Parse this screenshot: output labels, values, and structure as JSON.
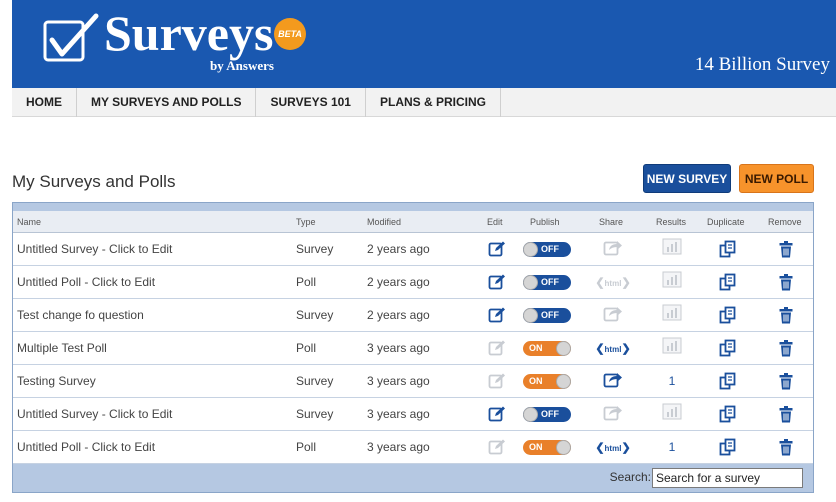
{
  "brand": {
    "logo_text": "Surveys",
    "logo_by": "by Answers",
    "beta": "BETA",
    "tagline": "14 Billion Survey"
  },
  "nav": {
    "items": [
      {
        "label": "HOME"
      },
      {
        "label": "MY SURVEYS AND POLLS"
      },
      {
        "label": "SURVEYS 101"
      },
      {
        "label": "PLANS & PRICING"
      }
    ]
  },
  "page": {
    "title": "My Surveys and Polls",
    "new_survey": "NEW SURVEY",
    "new_poll": "NEW POLL"
  },
  "table": {
    "columns": {
      "name": "Name",
      "type": "Type",
      "modified": "Modified",
      "edit": "Edit",
      "publish": "Publish",
      "share": "Share",
      "results": "Results",
      "duplicate": "Duplicate",
      "remove": "Remove"
    },
    "rows": [
      {
        "name": "Untitled Survey - Click to Edit",
        "type": "Survey",
        "modified": "2 years ago",
        "edit_enabled": true,
        "publish": "OFF",
        "share": "share-dim",
        "results": "chart-dim"
      },
      {
        "name": "Untitled Poll - Click to Edit",
        "type": "Poll",
        "modified": "2 years ago",
        "edit_enabled": true,
        "publish": "OFF",
        "share": "html-dim",
        "results": "chart-dim"
      },
      {
        "name": "Test change fo question",
        "type": "Survey",
        "modified": "2 years ago",
        "edit_enabled": true,
        "publish": "OFF",
        "share": "share-dim",
        "results": "chart-dim"
      },
      {
        "name": "Multiple Test Poll",
        "type": "Poll",
        "modified": "3 years ago",
        "edit_enabled": false,
        "publish": "ON",
        "share": "html",
        "results": "chart-dim"
      },
      {
        "name": "Testing Survey",
        "type": "Survey",
        "modified": "3 years ago",
        "edit_enabled": false,
        "publish": "ON",
        "share": "share",
        "results": "1"
      },
      {
        "name": "Untitled Survey - Click to Edit",
        "type": "Survey",
        "modified": "3 years ago",
        "edit_enabled": true,
        "publish": "OFF",
        "share": "share-dim",
        "results": "chart-dim"
      },
      {
        "name": "Untitled Poll - Click to Edit",
        "type": "Poll",
        "modified": "3 years ago",
        "edit_enabled": false,
        "publish": "ON",
        "share": "html",
        "results": "1"
      }
    ],
    "html_label": "html"
  },
  "search": {
    "label": "Search:",
    "value": "Search for a survey"
  },
  "colors": {
    "header_blue": "#1a58b0",
    "button_blue": "#1a4f9c",
    "button_orange": "#f7932b",
    "table_frame": "#b5c8e2"
  }
}
